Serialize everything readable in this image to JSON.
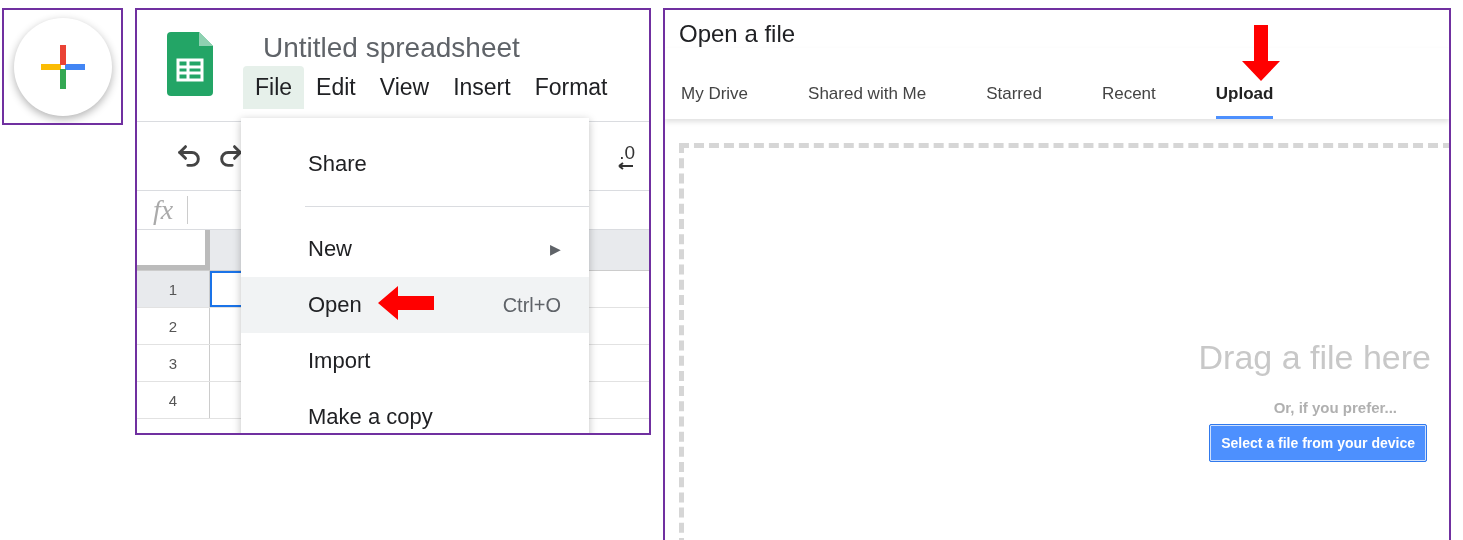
{
  "spreadsheet": {
    "title": "Untitled spreadsheet",
    "menus": [
      {
        "label": "File",
        "selected": true
      },
      {
        "label": "Edit",
        "selected": false
      },
      {
        "label": "View",
        "selected": false
      },
      {
        "label": "Insert",
        "selected": false
      },
      {
        "label": "Format",
        "selected": false
      }
    ],
    "decimal_button": ".0",
    "formula_label": "fx",
    "rows": [
      "1",
      "2",
      "3",
      "4"
    ],
    "file_menu": [
      {
        "kind": "item",
        "label": "Share",
        "highlighted": false
      },
      {
        "kind": "divider"
      },
      {
        "kind": "submenu",
        "label": "New",
        "arrow": "▶",
        "highlighted": false
      },
      {
        "kind": "item",
        "label": "Open",
        "shortcut": "Ctrl+O",
        "highlighted": true
      },
      {
        "kind": "item",
        "label": "Import",
        "highlighted": false
      },
      {
        "kind": "item",
        "label": "Make a copy",
        "highlighted": false
      }
    ]
  },
  "open_dialog": {
    "title": "Open a file",
    "tabs": [
      {
        "label": "My Drive",
        "selected": false
      },
      {
        "label": "Shared with Me",
        "selected": false
      },
      {
        "label": "Starred",
        "selected": false
      },
      {
        "label": "Recent",
        "selected": false
      },
      {
        "label": "Upload",
        "selected": true
      }
    ],
    "drop_zone": {
      "heading": "Drag a file here",
      "hint": "Or, if you prefer...",
      "button": "Select a file from your device"
    }
  }
}
